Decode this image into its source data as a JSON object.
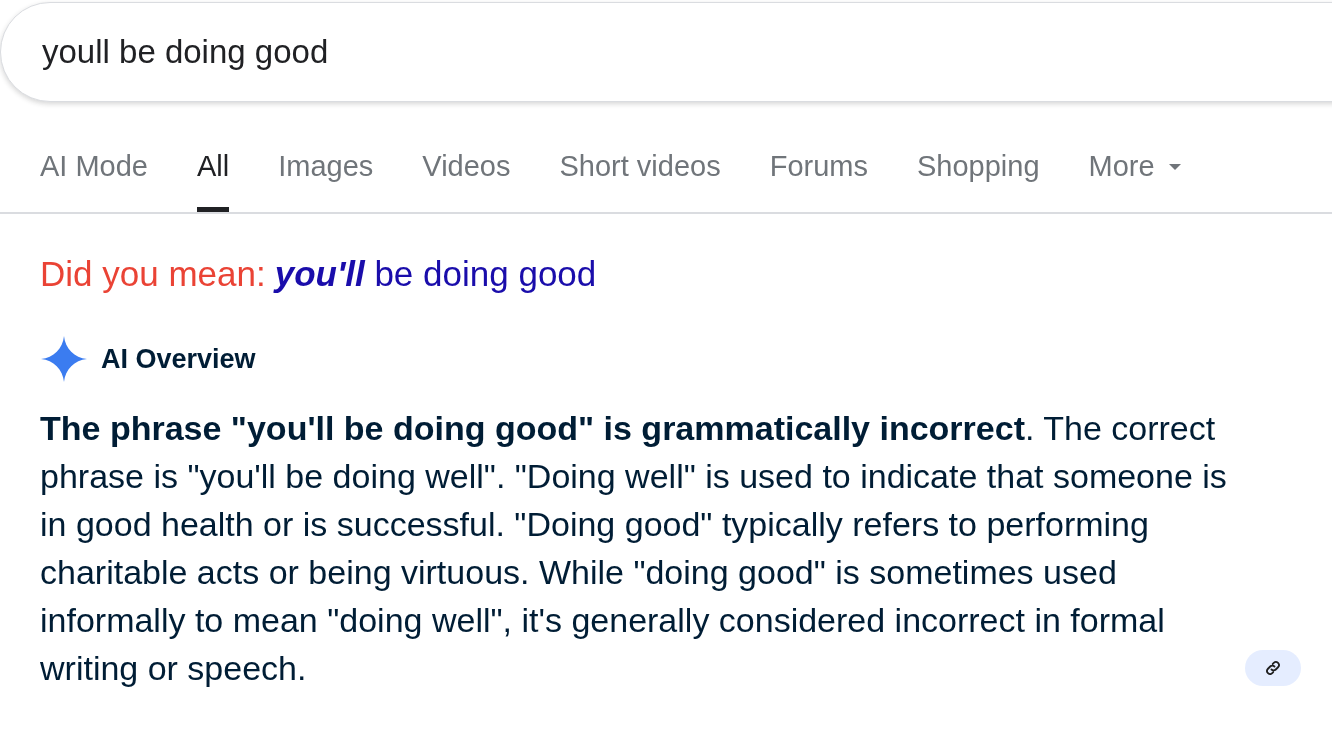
{
  "search": {
    "value": "youll be doing good"
  },
  "tabs": [
    {
      "label": "AI Mode",
      "selected": false,
      "kind": "plain"
    },
    {
      "label": "All",
      "selected": true,
      "kind": "plain"
    },
    {
      "label": "Images",
      "selected": false,
      "kind": "plain"
    },
    {
      "label": "Videos",
      "selected": false,
      "kind": "plain"
    },
    {
      "label": "Short videos",
      "selected": false,
      "kind": "plain"
    },
    {
      "label": "Forums",
      "selected": false,
      "kind": "plain"
    },
    {
      "label": "Shopping",
      "selected": false,
      "kind": "plain"
    },
    {
      "label": "More",
      "selected": false,
      "kind": "menu"
    }
  ],
  "spelling": {
    "prompt": "Did you mean:",
    "suggestion": "*you'll* be doing good"
  },
  "ai_overview": {
    "title": "AI Overview",
    "text": "**The phrase \"you'll be doing good\" is grammatically incorrect**. The correct phrase is \"you'll be doing well\". \"Doing well\" is used to indicate that someone is in good health or is successful. \"Doing good\" typically refers to performing charitable acts or being virtuous. While \"doing good\" is sometimes used informally to mean \"doing well\", it's generally considered incorrect in formal writing or speech."
  }
}
